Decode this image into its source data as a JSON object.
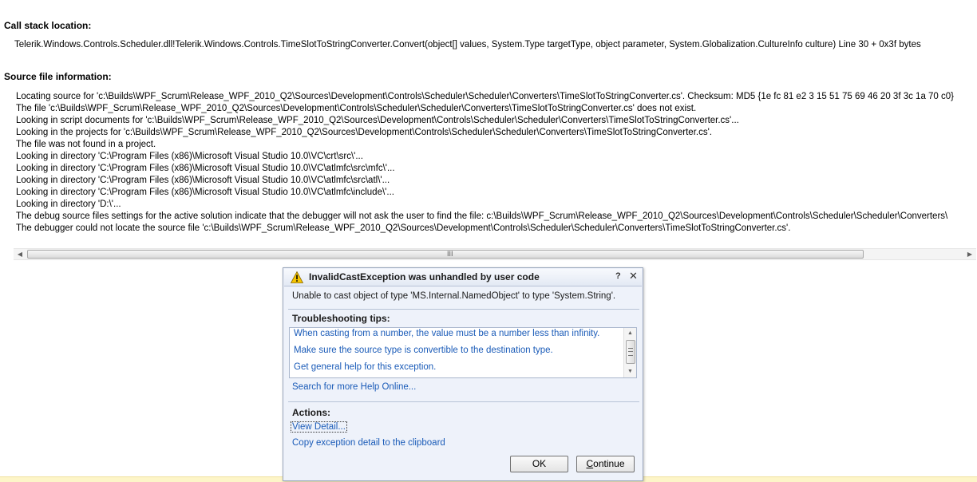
{
  "call_stack": {
    "heading": "Call stack location:",
    "location": "Telerik.Windows.Controls.Scheduler.dll!Telerik.Windows.Controls.TimeSlotToStringConverter.Convert(object[] values, System.Type targetType, object parameter, System.Globalization.CultureInfo culture) Line 30 + 0x3f bytes"
  },
  "source_info": {
    "heading": "Source file information:",
    "lines": [
      "Locating source for 'c:\\Builds\\WPF_Scrum\\Release_WPF_2010_Q2\\Sources\\Development\\Controls\\Scheduler\\Scheduler\\Converters\\TimeSlotToStringConverter.cs'. Checksum: MD5 {1e fc 81 e2 3 15 51 75 69 46 20 3f 3c 1a 70 c0}",
      "The file 'c:\\Builds\\WPF_Scrum\\Release_WPF_2010_Q2\\Sources\\Development\\Controls\\Scheduler\\Scheduler\\Converters\\TimeSlotToStringConverter.cs' does not exist.",
      "Looking in script documents for 'c:\\Builds\\WPF_Scrum\\Release_WPF_2010_Q2\\Sources\\Development\\Controls\\Scheduler\\Scheduler\\Converters\\TimeSlotToStringConverter.cs'...",
      "Looking in the projects for 'c:\\Builds\\WPF_Scrum\\Release_WPF_2010_Q2\\Sources\\Development\\Controls\\Scheduler\\Scheduler\\Converters\\TimeSlotToStringConverter.cs'.",
      "The file was not found in a project.",
      "Looking in directory 'C:\\Program Files (x86)\\Microsoft Visual Studio 10.0\\VC\\crt\\src\\'...",
      "Looking in directory 'C:\\Program Files (x86)\\Microsoft Visual Studio 10.0\\VC\\atlmfc\\src\\mfc\\'...",
      "Looking in directory 'C:\\Program Files (x86)\\Microsoft Visual Studio 10.0\\VC\\atlmfc\\src\\atl\\'...",
      "Looking in directory 'C:\\Program Files (x86)\\Microsoft Visual Studio 10.0\\VC\\atlmfc\\include\\'...",
      "Looking in directory 'D:\\'...",
      "The debug source files settings for the active solution indicate that the debugger will not ask the user to find the file: c:\\Builds\\WPF_Scrum\\Release_WPF_2010_Q2\\Sources\\Development\\Controls\\Scheduler\\Scheduler\\Converters\\",
      "The debugger could not locate the source file 'c:\\Builds\\WPF_Scrum\\Release_WPF_2010_Q2\\Sources\\Development\\Controls\\Scheduler\\Scheduler\\Converters\\TimeSlotToStringConverter.cs'."
    ]
  },
  "scrollbar": {
    "grip": "III"
  },
  "dialog": {
    "title": "InvalidCastException was unhandled by user code",
    "help_glyph": "?",
    "close_glyph": "✕",
    "message": "Unable to cast object of type 'MS.Internal.NamedObject' to type 'System.String'.",
    "troubleshooting_heading": "Troubleshooting tips:",
    "tips": [
      "When casting from a number, the value must be a number less than infinity.",
      "Make sure the source type is convertible to the destination type.",
      "Get general help for this exception."
    ],
    "search_link": "Search for more Help Online...",
    "actions_heading": "Actions:",
    "actions": [
      "View Detail...",
      "Copy exception detail to the clipboard"
    ],
    "ok_label": "OK",
    "continue_first": "C",
    "continue_rest": "ontinue",
    "warning_icon_color": "#f5c400"
  }
}
